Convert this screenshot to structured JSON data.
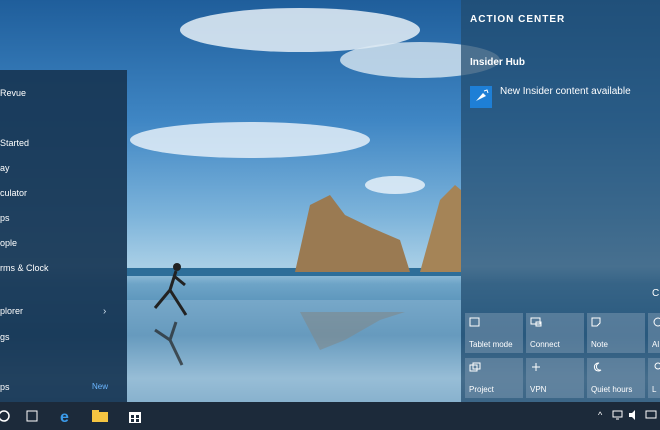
{
  "start_menu": {
    "items": [
      {
        "label": "Revue"
      },
      {
        "label": "Started"
      },
      {
        "label": "ay"
      },
      {
        "label": "culator"
      },
      {
        "label": "ps"
      },
      {
        "label": "ople"
      },
      {
        "label": "rms & Clock"
      },
      {
        "label": "plorer"
      },
      {
        "label": "gs"
      },
      {
        "label": "ps"
      }
    ],
    "new_badge": "New"
  },
  "action_center": {
    "title": "ACTION CENTER",
    "group": "Insider Hub",
    "notification": "New Insider content available",
    "collapse": "C",
    "quick_actions": [
      {
        "label": "Tablet mode",
        "icon": "tablet-mode-icon"
      },
      {
        "label": "Connect",
        "icon": "connect-icon"
      },
      {
        "label": "Note",
        "icon": "note-icon"
      },
      {
        "label": "Al",
        "icon": "settings-icon"
      },
      {
        "label": "Project",
        "icon": "project-icon"
      },
      {
        "label": "VPN",
        "icon": "vpn-icon"
      },
      {
        "label": "Quiet hours",
        "icon": "quiet-hours-icon"
      },
      {
        "label": "L",
        "icon": "location-icon"
      }
    ]
  },
  "taskbar": {
    "icons": [
      "search-icon",
      "task-view-icon",
      "edge-icon",
      "file-explorer-icon",
      "store-icon"
    ],
    "tray": [
      "chevron-up-icon",
      "network-icon",
      "volume-icon",
      "message-icon"
    ]
  },
  "colors": {
    "accent": "#1e7fd6",
    "taskbar": "#1c2a3a"
  }
}
